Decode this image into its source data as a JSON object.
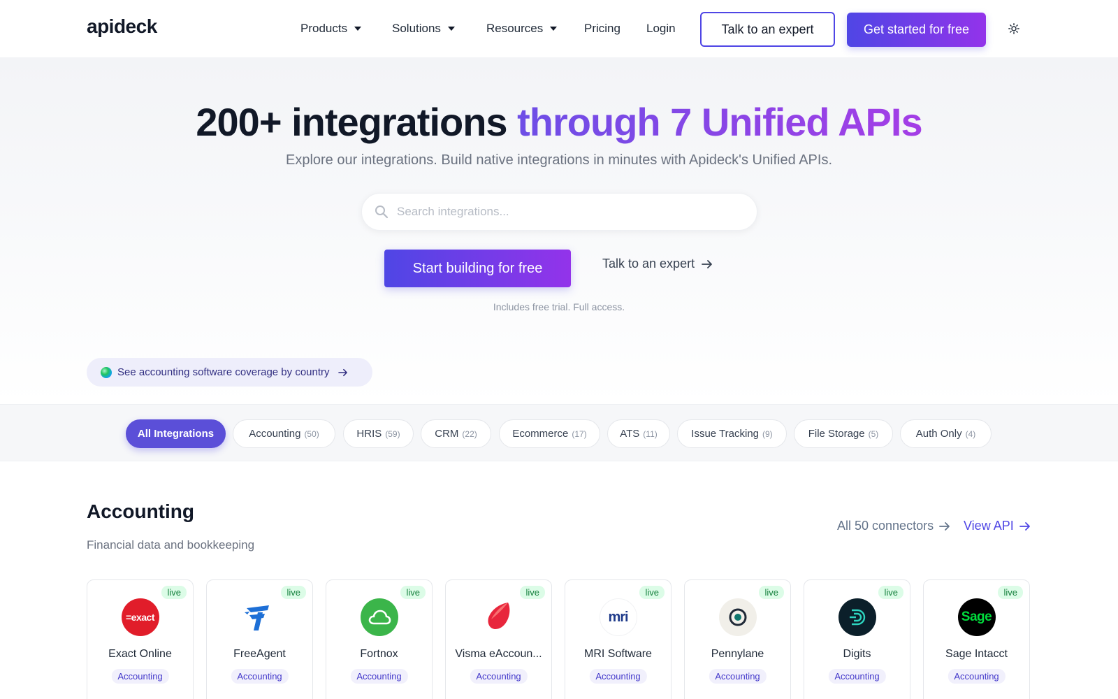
{
  "nav": {
    "logo": "apideck",
    "items": [
      {
        "label": "Products",
        "dropdown": true
      },
      {
        "label": "Solutions",
        "dropdown": true
      },
      {
        "label": "Resources",
        "dropdown": true
      },
      {
        "label": "Pricing",
        "dropdown": false
      },
      {
        "label": "Login",
        "dropdown": false
      }
    ],
    "talk_expert": "Talk to an expert",
    "get_started": "Get started for free",
    "theme_icon": "sun-icon"
  },
  "hero": {
    "title_main": "200+ integrations ",
    "title_accent": "through 7 Unified APIs",
    "subtitle": "Explore our integrations. Build native integrations in minutes with Apideck's Unified APIs.",
    "search_placeholder": "Search integrations...",
    "start_button": "Start building for free",
    "expert_link": "Talk to an expert",
    "note": "Includes free trial. Full access.",
    "coverage_link": "See accounting software coverage by country"
  },
  "filters": [
    {
      "label": "All Integrations",
      "count": "",
      "active": true
    },
    {
      "label": "Accounting",
      "count": "(50)",
      "active": false
    },
    {
      "label": "HRIS",
      "count": "(59)",
      "active": false
    },
    {
      "label": "CRM",
      "count": "(22)",
      "active": false
    },
    {
      "label": "Ecommerce",
      "count": "(17)",
      "active": false
    },
    {
      "label": "ATS",
      "count": "(11)",
      "active": false
    },
    {
      "label": "Issue Tracking",
      "count": "(9)",
      "active": false
    },
    {
      "label": "File Storage",
      "count": "(5)",
      "active": false
    },
    {
      "label": "Auth Only",
      "count": "(4)",
      "active": false
    }
  ],
  "accounting": {
    "title": "Accounting",
    "subtitle": "Financial data and bookkeeping",
    "all_link": "All 50 connectors",
    "api_link": "View API",
    "cards": [
      {
        "name": "Exact Online",
        "tag": "Accounting",
        "status": "live",
        "logo_text": "=exact",
        "logo_bg": "#e11d2a",
        "logo_fg": "#ffffff"
      },
      {
        "name": "FreeAgent",
        "tag": "Accounting",
        "status": "live",
        "logo_text": "F",
        "logo_bg": "#ffffff",
        "logo_fg": "#1d6fd6"
      },
      {
        "name": "Fortnox",
        "tag": "Accounting",
        "status": "live",
        "logo_text": "",
        "logo_bg": "#3bb54a",
        "logo_fg": "#ffffff"
      },
      {
        "name": "Visma eAccoun...",
        "tag": "Accounting",
        "status": "live",
        "logo_text": "",
        "logo_bg": "#ffffff",
        "logo_fg": "#e8263c"
      },
      {
        "name": "MRI Software",
        "tag": "Accounting",
        "status": "live",
        "logo_text": "mri",
        "logo_bg": "#ffffff",
        "logo_fg": "#1e3a8a"
      },
      {
        "name": "Pennylane",
        "tag": "Accounting",
        "status": "live",
        "logo_text": "",
        "logo_bg": "#f1efe9",
        "logo_fg": "#0f766e"
      },
      {
        "name": "Digits",
        "tag": "Accounting",
        "status": "live",
        "logo_text": "",
        "logo_bg": "#0b1f2a",
        "logo_fg": "#2dd4bf"
      },
      {
        "name": "Sage Intacct",
        "tag": "Accounting",
        "status": "live",
        "logo_text": "Sage",
        "logo_bg": "#000000",
        "logo_fg": "#00dc3c"
      }
    ]
  },
  "colors": {
    "accent": "#4f46e5",
    "accent2": "#9333ea",
    "live_bg": "#dcfce7",
    "live_fg": "#15803d"
  }
}
